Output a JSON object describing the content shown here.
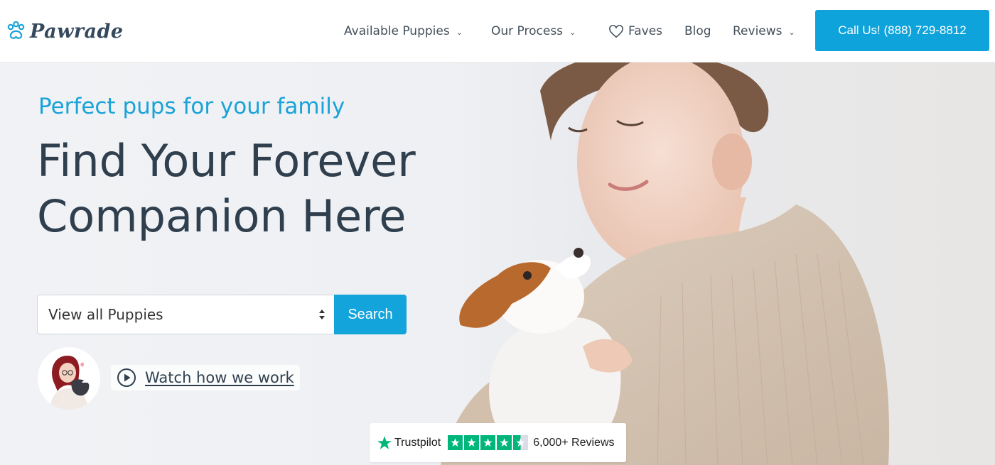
{
  "brand": {
    "name": "Pawrade",
    "accent": "#14a4dc",
    "text": "#2f3f4e"
  },
  "nav": {
    "items": [
      {
        "label": "Available Puppies",
        "dropdown": true
      },
      {
        "label": "Our Process",
        "dropdown": true
      },
      {
        "label": "Faves",
        "icon": "heart-icon"
      },
      {
        "label": "Blog"
      },
      {
        "label": "Reviews",
        "dropdown": true
      }
    ],
    "call_label": "Call Us! (888) 729-8812"
  },
  "hero": {
    "tagline": "Perfect pups for your family",
    "headline_line1": "Find Your Forever",
    "headline_line2": "Companion Here",
    "search": {
      "selected": "View all Puppies",
      "button_label": "Search"
    },
    "watch_label": "Watch how we work"
  },
  "trustpilot": {
    "name": "Trustpilot",
    "rating_stars": 4.5,
    "reviews_label": "6,000+ Reviews",
    "color": "#00b67a"
  }
}
